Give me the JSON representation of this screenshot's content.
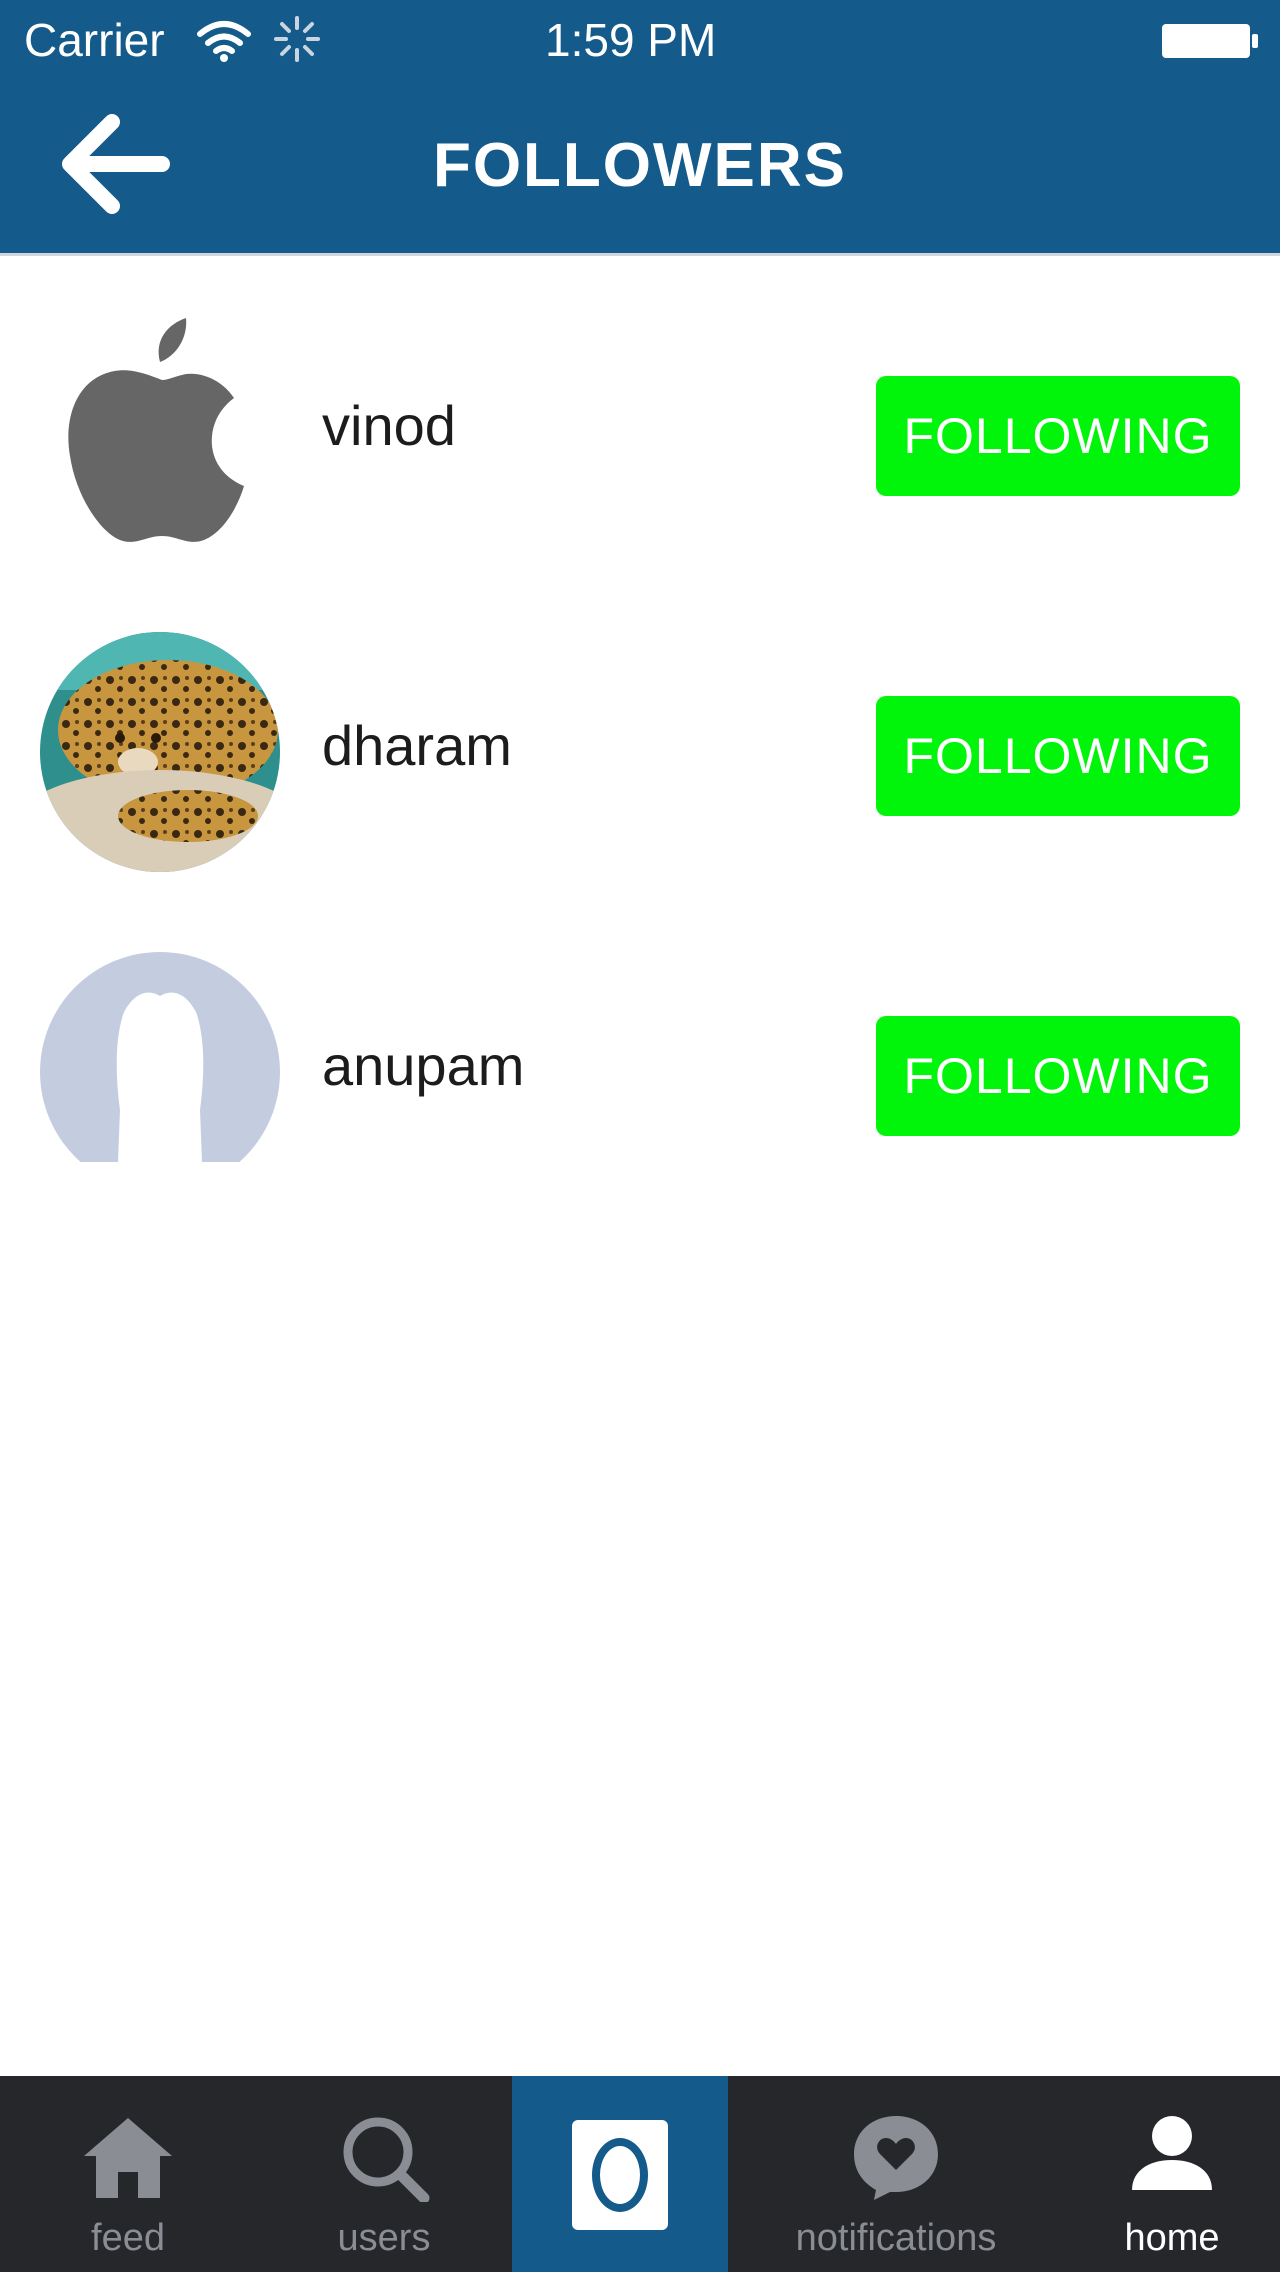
{
  "status_bar": {
    "carrier": "Carrier",
    "time": "1:59 PM"
  },
  "nav": {
    "title": "FOLLOWERS"
  },
  "followers": [
    {
      "name": "vinod",
      "button_label": "FOLLOWING",
      "avatar": "apple-logo"
    },
    {
      "name": "dharam",
      "button_label": "FOLLOWING",
      "avatar": "leopard-photo"
    },
    {
      "name": "anupam",
      "button_label": "FOLLOWING",
      "avatar": "default-silhouette"
    }
  ],
  "tabbar": {
    "tabs": [
      {
        "label": "feed",
        "icon": "home-icon"
      },
      {
        "label": "users",
        "icon": "search-icon"
      },
      {
        "label": "",
        "icon": "camera-icon"
      },
      {
        "label": "notifications",
        "icon": "heart-bubble-icon"
      },
      {
        "label": "home",
        "icon": "person-icon",
        "active": true
      }
    ]
  },
  "colors": {
    "header": "#145a8a",
    "button": "#00f50a",
    "tabbar": "#25272b",
    "tab_inactive": "#8a8d93",
    "tab_active": "#ffffff"
  }
}
